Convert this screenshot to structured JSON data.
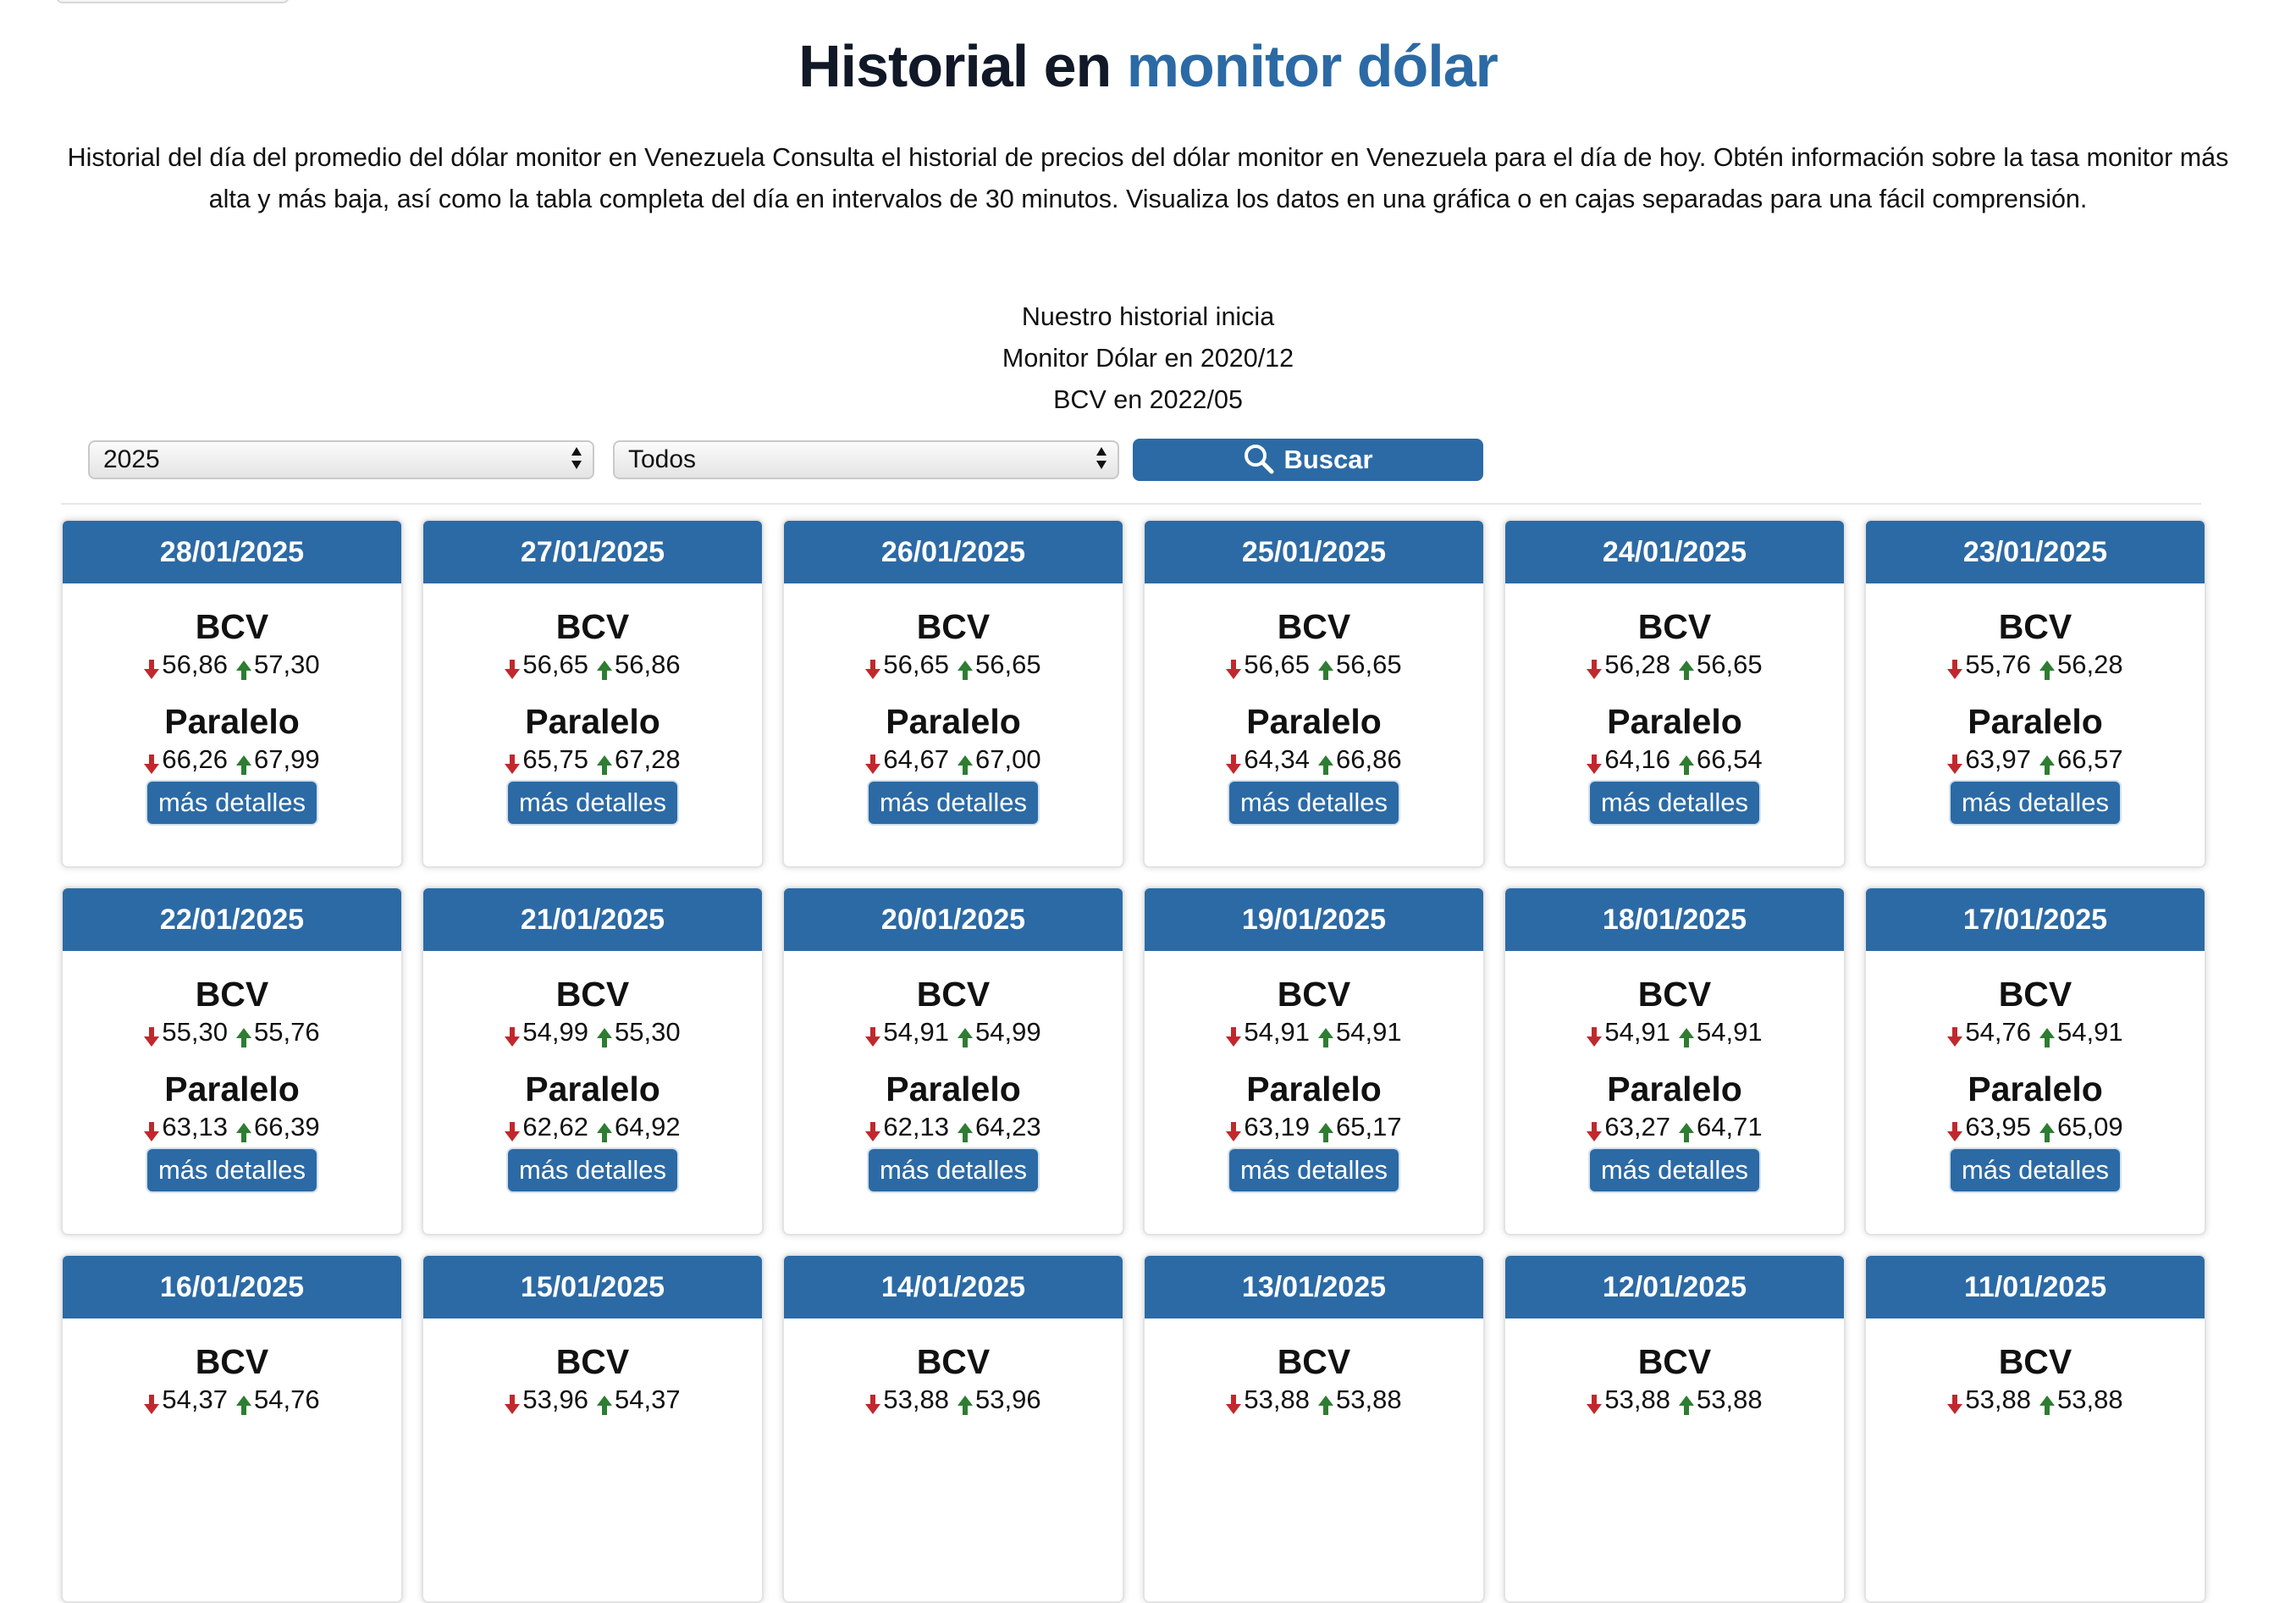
{
  "title": {
    "main": "Historial en",
    "accent": "monitor dólar"
  },
  "intro": "Historial del día del promedio del dólar monitor en Venezuela Consulta el historial de precios del dólar monitor en Venezuela para el día de hoy. Obtén información sobre la tasa monitor más alta y más baja, así como la tabla completa del día en intervalos de 30 minutos. Visualiza los datos en una gráfica o en cajas separadas para una fácil comprensión.",
  "history_info": {
    "line1": "Nuestro historial inicia",
    "line2": "Monitor Dólar en 2020/12",
    "line3": "BCV en 2022/05"
  },
  "filters": {
    "year_value": "2025",
    "month_value": "Todos",
    "search_label": "Buscar",
    "search_icon": "search-icon"
  },
  "labels": {
    "bcv": "BCV",
    "paralelo": "Paralelo",
    "details": "más detalles"
  },
  "colors": {
    "primary": "#2c6aa5",
    "down_arrow": "#c0282d",
    "up_arrow": "#2e7d32"
  },
  "cards": [
    {
      "date": "28/01/2025",
      "bcv_low": "56,86",
      "bcv_high": "57,30",
      "par_low": "66,26",
      "par_high": "67,99"
    },
    {
      "date": "27/01/2025",
      "bcv_low": "56,65",
      "bcv_high": "56,86",
      "par_low": "65,75",
      "par_high": "67,28"
    },
    {
      "date": "26/01/2025",
      "bcv_low": "56,65",
      "bcv_high": "56,65",
      "par_low": "64,67",
      "par_high": "67,00"
    },
    {
      "date": "25/01/2025",
      "bcv_low": "56,65",
      "bcv_high": "56,65",
      "par_low": "64,34",
      "par_high": "66,86"
    },
    {
      "date": "24/01/2025",
      "bcv_low": "56,28",
      "bcv_high": "56,65",
      "par_low": "64,16",
      "par_high": "66,54"
    },
    {
      "date": "23/01/2025",
      "bcv_low": "55,76",
      "bcv_high": "56,28",
      "par_low": "63,97",
      "par_high": "66,57"
    },
    {
      "date": "22/01/2025",
      "bcv_low": "55,30",
      "bcv_high": "55,76",
      "par_low": "63,13",
      "par_high": "66,39"
    },
    {
      "date": "21/01/2025",
      "bcv_low": "54,99",
      "bcv_high": "55,30",
      "par_low": "62,62",
      "par_high": "64,92"
    },
    {
      "date": "20/01/2025",
      "bcv_low": "54,91",
      "bcv_high": "54,99",
      "par_low": "62,13",
      "par_high": "64,23"
    },
    {
      "date": "19/01/2025",
      "bcv_low": "54,91",
      "bcv_high": "54,91",
      "par_low": "63,19",
      "par_high": "65,17"
    },
    {
      "date": "18/01/2025",
      "bcv_low": "54,91",
      "bcv_high": "54,91",
      "par_low": "63,27",
      "par_high": "64,71"
    },
    {
      "date": "17/01/2025",
      "bcv_low": "54,76",
      "bcv_high": "54,91",
      "par_low": "63,95",
      "par_high": "65,09"
    },
    {
      "date": "16/01/2025",
      "bcv_low": "54,37",
      "bcv_high": "54,76",
      "par_low": "",
      "par_high": ""
    },
    {
      "date": "15/01/2025",
      "bcv_low": "53,96",
      "bcv_high": "54,37",
      "par_low": "",
      "par_high": ""
    },
    {
      "date": "14/01/2025",
      "bcv_low": "53,88",
      "bcv_high": "53,96",
      "par_low": "",
      "par_high": ""
    },
    {
      "date": "13/01/2025",
      "bcv_low": "53,88",
      "bcv_high": "53,88",
      "par_low": "",
      "par_high": ""
    },
    {
      "date": "12/01/2025",
      "bcv_low": "53,88",
      "bcv_high": "53,88",
      "par_low": "",
      "par_high": ""
    },
    {
      "date": "11/01/2025",
      "bcv_low": "53,88",
      "bcv_high": "53,88",
      "par_low": "",
      "par_high": ""
    }
  ]
}
